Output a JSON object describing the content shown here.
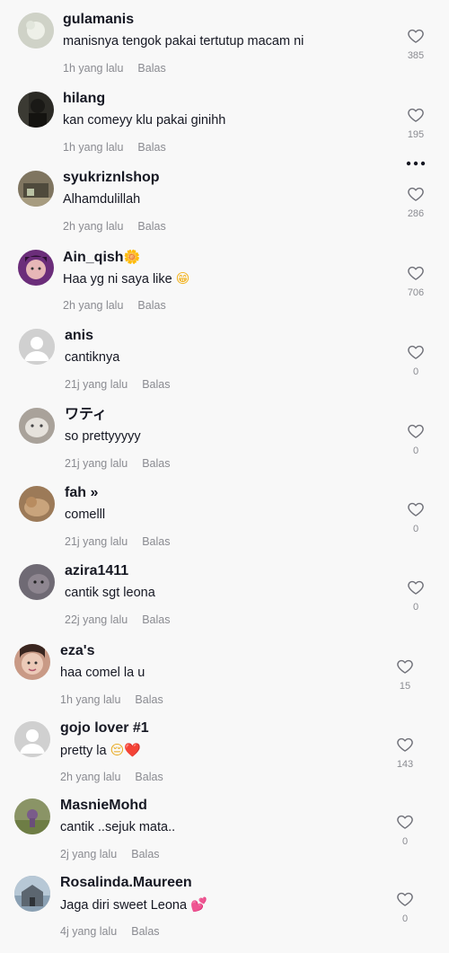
{
  "comments": [
    {
      "username": "gulamanis",
      "text": "manisnya tengok pakai tertutup macam ni",
      "time": "1h yang lalu",
      "reply": "Balas",
      "likes": "385",
      "emoji": "",
      "emoji_cls": "",
      "avatar": "flower-photo",
      "avatar_bg": "#cfd2c7"
    },
    {
      "username": "hilang",
      "text": "kan comeyy klu pakai ginihh",
      "time": "1h yang lalu",
      "reply": "Balas",
      "likes": "195",
      "emoji": "",
      "emoji_cls": "",
      "avatar": "dark-silhouette",
      "avatar_bg": "#2b2a25"
    },
    {
      "username": "syukriznlshop",
      "text": "Alhamdulillah",
      "time": "2h yang lalu",
      "reply": "Balas",
      "likes": "286",
      "emoji": "",
      "emoji_cls": "",
      "avatar": "shop-photo",
      "avatar_bg": "#7f7560"
    },
    {
      "username": "Ain_qish",
      "text": "Haa yg ni saya like",
      "time": "2h yang lalu",
      "reply": "Balas",
      "likes": "706",
      "emoji": "🌼",
      "emoji_cls": "flower",
      "text_emoji": "😁",
      "text_emoji_cls": "grin",
      "avatar": "purple-portrait",
      "avatar_bg": "#6b2d7a"
    },
    {
      "username": "anis",
      "text": "cantiknya",
      "time": "21j yang lalu",
      "reply": "Balas",
      "likes": "0",
      "emoji": "",
      "emoji_cls": "",
      "avatar": "default-avatar",
      "avatar_bg": "#d0d0d0"
    },
    {
      "username": "ワティ",
      "text": "so prettyyyyy",
      "time": "21j yang lalu",
      "reply": "Balas",
      "likes": "0",
      "emoji": "",
      "emoji_cls": "",
      "avatar": "cat-photo",
      "avatar_bg": "#a9a29a"
    },
    {
      "username": "fah »",
      "text": "comelll",
      "time": "21j yang lalu",
      "reply": "Balas",
      "likes": "0",
      "emoji": "",
      "emoji_cls": "",
      "avatar": "pet-photo",
      "avatar_bg": "#9c7a58"
    },
    {
      "username": "azira1411",
      "text": "cantik sgt leona",
      "time": "22j yang lalu",
      "reply": "Balas",
      "likes": "0",
      "emoji": "",
      "emoji_cls": "",
      "avatar": "cat-photo-2",
      "avatar_bg": "#6f6a74"
    },
    {
      "username": "eza's",
      "text": "haa comel la u",
      "time": "1h yang lalu",
      "reply": "Balas",
      "likes": "15",
      "emoji": "",
      "emoji_cls": "",
      "avatar": "face-portrait",
      "avatar_bg": "#c99a86"
    },
    {
      "username": "gojo lover #1",
      "text": "pretty la",
      "time": "2h yang lalu",
      "reply": "Balas",
      "likes": "143",
      "emoji": "",
      "emoji_cls": "",
      "text_emoji": "😔❤️",
      "text_emoji_cls": "sad",
      "avatar": "default-avatar",
      "avatar_bg": "#d0d0d0"
    },
    {
      "username": "MasnieMohd",
      "text": "cantik ..sejuk mata..",
      "time": "2j yang lalu",
      "reply": "Balas",
      "likes": "0",
      "emoji": "",
      "emoji_cls": "",
      "avatar": "outdoor-photo",
      "avatar_bg": "#8a9466"
    },
    {
      "username": "Rosalinda.Maureen",
      "text": "Jaga diri sweet Leona",
      "time": "4j yang lalu",
      "reply": "Balas",
      "likes": "0",
      "emoji": "",
      "emoji_cls": "",
      "text_emoji": "💕",
      "text_emoji_cls": "heart-pink",
      "avatar": "building-photo",
      "avatar_bg": "#8aa0b3"
    }
  ],
  "icons": {
    "like": "heart-outline-icon",
    "more": "more-options-icon"
  },
  "colors": {
    "background": "#f8f8f8",
    "text": "#161823",
    "muted": "#8a8b91"
  }
}
